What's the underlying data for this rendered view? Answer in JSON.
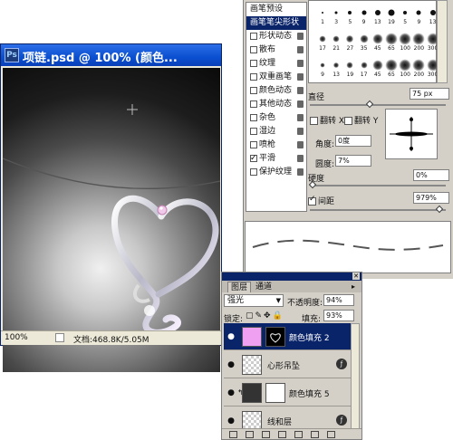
{
  "document_window": {
    "title": "项链.psd @ 100% (颜色...",
    "ps_icon": "photoshop-icon",
    "zoom": "100%",
    "doc_info": "文档:468.8K/5.05M"
  },
  "brush_panel": {
    "list_items": [
      {
        "label": "画笔预设",
        "checkbox": false,
        "lock": false,
        "selected": false
      },
      {
        "label": "画笔笔尖形状",
        "checkbox": false,
        "lock": false,
        "selected": true
      },
      {
        "label": "形状动态",
        "checkbox": true,
        "checked": false,
        "lock": true,
        "selected": false
      },
      {
        "label": "散布",
        "checkbox": true,
        "checked": false,
        "lock": true,
        "selected": false
      },
      {
        "label": "纹理",
        "checkbox": true,
        "checked": false,
        "lock": true,
        "selected": false
      },
      {
        "label": "双重画笔",
        "checkbox": true,
        "checked": false,
        "lock": true,
        "selected": false
      },
      {
        "label": "颜色动态",
        "checkbox": true,
        "checked": false,
        "lock": true,
        "selected": false
      },
      {
        "label": "其他动态",
        "checkbox": true,
        "checked": false,
        "lock": true,
        "selected": false
      },
      {
        "label": "杂色",
        "checkbox": true,
        "checked": false,
        "lock": true,
        "selected": false
      },
      {
        "label": "湿边",
        "checkbox": true,
        "checked": false,
        "lock": true,
        "selected": false
      },
      {
        "label": "喷枪",
        "checkbox": true,
        "checked": false,
        "lock": true,
        "selected": false
      },
      {
        "label": "平滑",
        "checkbox": true,
        "checked": true,
        "lock": true,
        "selected": false
      },
      {
        "label": "保护纹理",
        "checkbox": true,
        "checked": false,
        "lock": true,
        "selected": false
      }
    ],
    "tips": [
      "1",
      "3",
      "5",
      "9",
      "13",
      "19",
      "5",
      "9",
      "13",
      "17",
      "21",
      "27",
      "35",
      "45",
      "65",
      "100",
      "200",
      "300",
      "9",
      "13",
      "19",
      "17",
      "45",
      "65",
      "100",
      "200",
      "300"
    ],
    "diameter_label": "直径",
    "diameter_value": "75 px",
    "flip_x_label": "翻转 X",
    "flip_y_label": "翻转 Y",
    "angle_label": "角度:",
    "angle_value": "0度",
    "roundness_label": "圆度:",
    "roundness_value": "7%",
    "hardness_label": "硬度",
    "hardness_value": "0%",
    "spacing_label": "间距",
    "spacing_value": "979%",
    "spacing_checked": true
  },
  "layers_panel": {
    "tab_layers": "图层",
    "tab_channels": "通道",
    "blend_mode": "强光",
    "opacity_label": "不透明度:",
    "opacity_value": "94%",
    "lock_label": "锁定:",
    "fill_label": "填充:",
    "fill_value": "93%",
    "layers": [
      {
        "name": "颜色填充 2",
        "active": true
      },
      {
        "name": "心形吊坠",
        "active": false
      },
      {
        "name": "颜色填充 5",
        "active": false
      },
      {
        "name": "线和层",
        "active": false
      }
    ]
  },
  "colors": {
    "titlebar": "#0a4fd0",
    "selection": "#0a246a",
    "fill_pink": "#f0a0f0"
  }
}
